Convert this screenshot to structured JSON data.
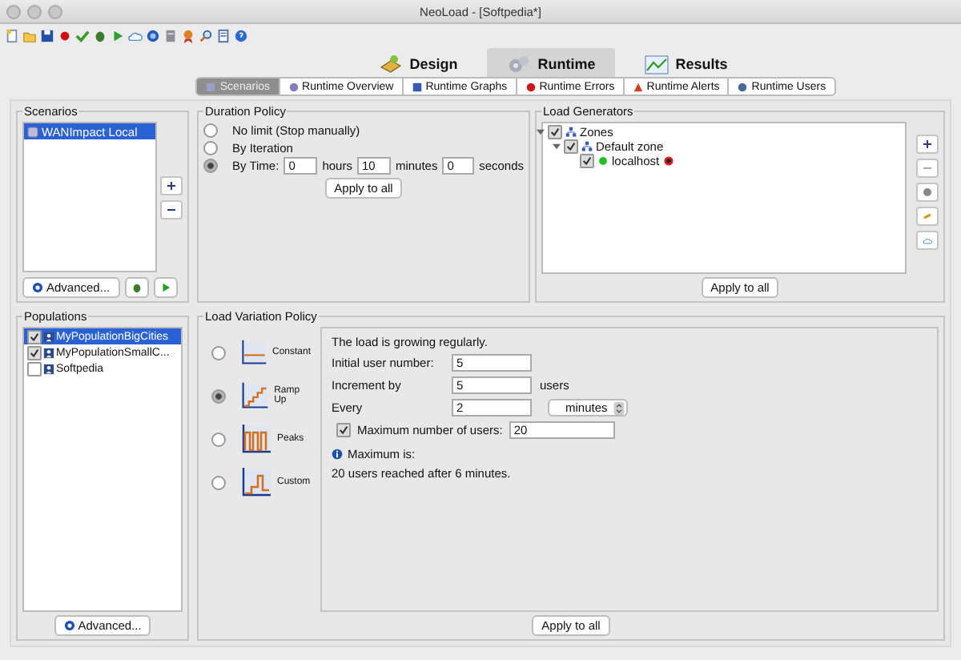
{
  "window": {
    "title": "NeoLoad - [Softpedia*]"
  },
  "main_tabs": [
    {
      "label": "Design",
      "selected": false,
      "kind": "design"
    },
    {
      "label": "Runtime",
      "selected": true,
      "kind": "runtime"
    },
    {
      "label": "Results",
      "selected": false,
      "kind": "results"
    }
  ],
  "sub_tabs": [
    {
      "label": "Scenarios",
      "selected": true,
      "kind": "scenarios"
    },
    {
      "label": "Runtime Overview",
      "selected": false,
      "kind": "overview"
    },
    {
      "label": "Runtime Graphs",
      "selected": false,
      "kind": "graphs"
    },
    {
      "label": "Runtime Errors",
      "selected": false,
      "kind": "errors"
    },
    {
      "label": "Runtime Alerts",
      "selected": false,
      "kind": "alerts"
    },
    {
      "label": "Runtime Users",
      "selected": false,
      "kind": "users"
    }
  ],
  "scenarios": {
    "title": "Scenarios",
    "items": [
      {
        "label": "WANImpact Local",
        "selected": true
      }
    ],
    "advanced_button": "Advanced..."
  },
  "populations": {
    "title": "Populations",
    "items": [
      {
        "label": "MyPopulationBigCities",
        "checked": true,
        "selected": true
      },
      {
        "label": "MyPopulationSmallC...",
        "checked": true,
        "selected": false
      },
      {
        "label": "Softpedia",
        "checked": false,
        "selected": false
      }
    ],
    "advanced_button": "Advanced..."
  },
  "duration_policy": {
    "title": "Duration Policy",
    "options": [
      {
        "label": "No limit (Stop manually)",
        "selected": false
      },
      {
        "label": "By Iteration",
        "selected": false
      },
      {
        "label": "By Time:",
        "selected": true
      }
    ],
    "hours": "0",
    "hours_label": "hours",
    "minutes": "10",
    "minutes_label": "minutes",
    "seconds": "0",
    "seconds_label": "seconds",
    "apply_button": "Apply to all"
  },
  "load_generators": {
    "title": "Load Generators",
    "tree": [
      {
        "label": "Zones",
        "checked": true,
        "kind": "zone",
        "children": [
          {
            "label": "Default zone",
            "checked": true,
            "kind": "zone",
            "expanded": true,
            "children": [
              {
                "label": "localhost",
                "checked": true,
                "kind": "host"
              }
            ]
          }
        ]
      }
    ],
    "apply_button": "Apply to all"
  },
  "load_variation": {
    "title": "Load Variation Policy",
    "policies": [
      {
        "label": "Constant",
        "selected": false,
        "kind": "constant"
      },
      {
        "label": "Ramp Up",
        "selected": true,
        "kind": "ramp"
      },
      {
        "label": "Peaks",
        "selected": false,
        "kind": "peaks"
      },
      {
        "label": "Custom",
        "selected": false,
        "kind": "custom"
      }
    ],
    "description": "The load is growing regularly.",
    "fields": [
      {
        "label": "Initial user number:",
        "value": "5"
      },
      {
        "label": "Increment by",
        "value": "5",
        "unit": "users"
      },
      {
        "label": "Every",
        "value": "2",
        "select": "minutes"
      }
    ],
    "max_users": {
      "checked": true,
      "label": "Maximum number of users:",
      "value": "20"
    },
    "info_title": "Maximum is:",
    "info_text": "20 users reached after 6 minutes.",
    "apply_button": "Apply to all"
  }
}
